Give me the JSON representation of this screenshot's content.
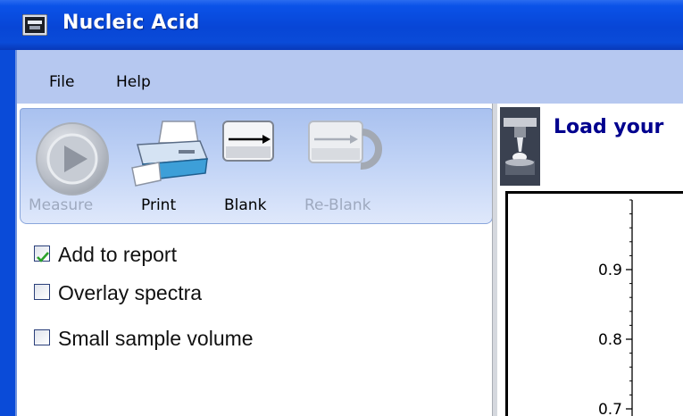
{
  "window": {
    "title": "Nucleic Acid"
  },
  "menu": {
    "items": [
      "File",
      "Help"
    ]
  },
  "toolbar": {
    "measure": {
      "label": "Measure",
      "enabled": false
    },
    "print": {
      "label": "Print",
      "enabled": true
    },
    "blank": {
      "label": "Blank",
      "enabled": true
    },
    "reblank": {
      "label": "Re-Blank",
      "enabled": false
    }
  },
  "options": [
    {
      "label": "Add to report",
      "checked": true
    },
    {
      "label": "Overlay spectra",
      "checked": false
    },
    {
      "label": "Small sample volume",
      "checked": false
    }
  ],
  "status": {
    "text": "Load your"
  },
  "colors": {
    "titlebar": "#0a4bd8",
    "menubar": "#b6c8f0",
    "check": "#2aa12a",
    "status_text": "#00008e"
  },
  "chart_data": {
    "type": "line",
    "y_ticks": [
      "0.9",
      "0.8",
      "0.7"
    ],
    "ylim": [
      0.65,
      1.0
    ],
    "series": []
  }
}
